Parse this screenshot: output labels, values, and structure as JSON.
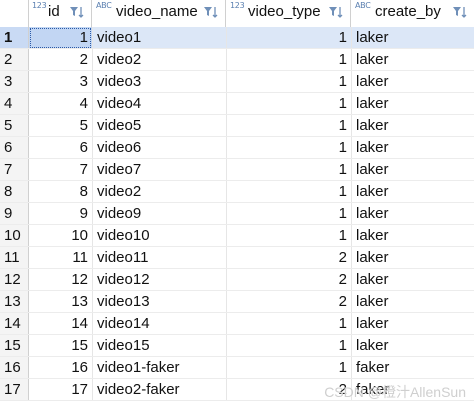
{
  "columns": [
    {
      "type_badge": "123",
      "label": "id"
    },
    {
      "type_badge": "ABC",
      "label": "video_name"
    },
    {
      "type_badge": "123",
      "label": "video_type"
    },
    {
      "type_badge": "ABC",
      "label": "create_by"
    }
  ],
  "rows": [
    {
      "n": "1",
      "id": "1",
      "video_name": "video1",
      "video_type": "1",
      "create_by": "laker"
    },
    {
      "n": "2",
      "id": "2",
      "video_name": "video2",
      "video_type": "1",
      "create_by": "laker"
    },
    {
      "n": "3",
      "id": "3",
      "video_name": "video3",
      "video_type": "1",
      "create_by": "laker"
    },
    {
      "n": "4",
      "id": "4",
      "video_name": "video4",
      "video_type": "1",
      "create_by": "laker"
    },
    {
      "n": "5",
      "id": "5",
      "video_name": "video5",
      "video_type": "1",
      "create_by": "laker"
    },
    {
      "n": "6",
      "id": "6",
      "video_name": "video6",
      "video_type": "1",
      "create_by": "laker"
    },
    {
      "n": "7",
      "id": "7",
      "video_name": "video7",
      "video_type": "1",
      "create_by": "laker"
    },
    {
      "n": "8",
      "id": "8",
      "video_name": "video2",
      "video_type": "1",
      "create_by": "laker"
    },
    {
      "n": "9",
      "id": "9",
      "video_name": "video9",
      "video_type": "1",
      "create_by": "laker"
    },
    {
      "n": "10",
      "id": "10",
      "video_name": "video10",
      "video_type": "1",
      "create_by": "laker"
    },
    {
      "n": "11",
      "id": "11",
      "video_name": "video11",
      "video_type": "2",
      "create_by": "laker"
    },
    {
      "n": "12",
      "id": "12",
      "video_name": "video12",
      "video_type": "2",
      "create_by": "laker"
    },
    {
      "n": "13",
      "id": "13",
      "video_name": "video13",
      "video_type": "2",
      "create_by": "laker"
    },
    {
      "n": "14",
      "id": "14",
      "video_name": "video14",
      "video_type": "1",
      "create_by": "laker"
    },
    {
      "n": "15",
      "id": "15",
      "video_name": "video15",
      "video_type": "1",
      "create_by": "laker"
    },
    {
      "n": "16",
      "id": "16",
      "video_name": "video1-faker",
      "video_type": "1",
      "create_by": "faker"
    },
    {
      "n": "17",
      "id": "17",
      "video_name": "video2-faker",
      "video_type": "2",
      "create_by": "faker"
    }
  ],
  "watermark": "CSDN @橙汁AllenSun"
}
